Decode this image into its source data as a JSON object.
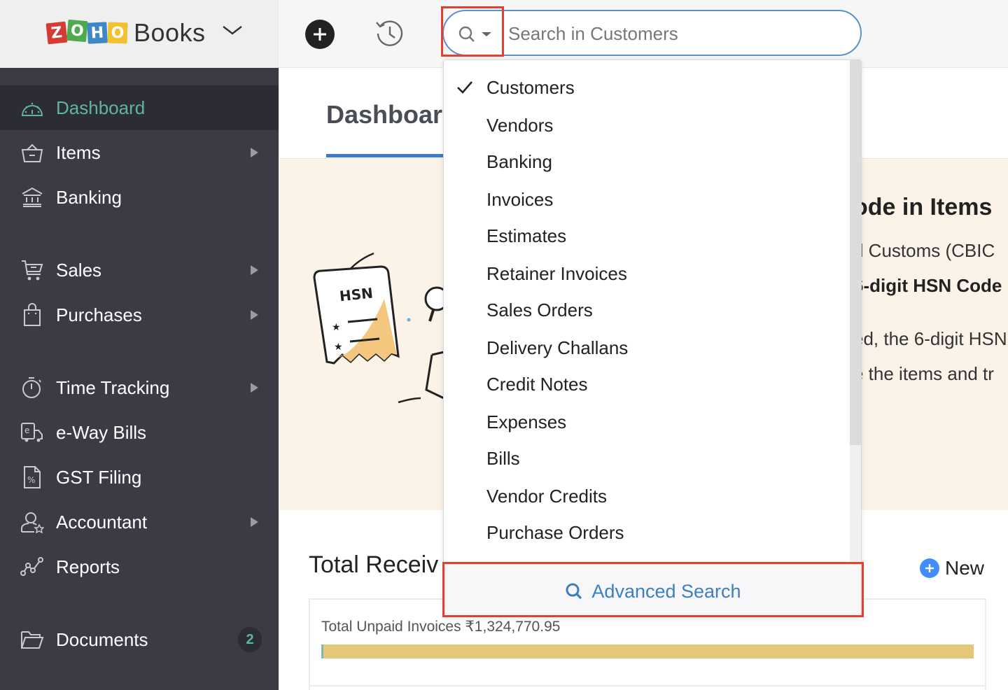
{
  "brand": {
    "logo_letters": [
      "Z",
      "O",
      "H",
      "O"
    ],
    "product_name": "Books"
  },
  "sidebar": {
    "items": [
      {
        "label": "Dashboard",
        "icon": "dashboard-gauge-icon",
        "active": true,
        "has_submenu": false
      },
      {
        "label": "Items",
        "icon": "basket-icon",
        "active": false,
        "has_submenu": true
      },
      {
        "label": "Banking",
        "icon": "bank-icon",
        "active": false,
        "has_submenu": false
      },
      {
        "label": "Sales",
        "icon": "cart-icon",
        "active": false,
        "has_submenu": true
      },
      {
        "label": "Purchases",
        "icon": "shopping-bag-icon",
        "active": false,
        "has_submenu": true
      },
      {
        "label": "Time Tracking",
        "icon": "stopwatch-icon",
        "active": false,
        "has_submenu": true
      },
      {
        "label": "e-Way Bills",
        "icon": "eway-truck-icon",
        "active": false,
        "has_submenu": false
      },
      {
        "label": "GST Filing",
        "icon": "tax-document-icon",
        "active": false,
        "has_submenu": false
      },
      {
        "label": "Accountant",
        "icon": "accountant-user-icon",
        "active": false,
        "has_submenu": true
      },
      {
        "label": "Reports",
        "icon": "reports-graph-icon",
        "active": false,
        "has_submenu": false
      },
      {
        "label": "Documents",
        "icon": "folder-icon",
        "active": false,
        "has_submenu": false,
        "badge": "2"
      }
    ]
  },
  "topbar": {
    "search": {
      "placeholder": "Search in Customers",
      "value": "",
      "selected_scope": "Customers"
    }
  },
  "search_dropdown": {
    "options": [
      {
        "label": "Customers",
        "selected": true
      },
      {
        "label": "Vendors",
        "selected": false
      },
      {
        "label": "Banking",
        "selected": false
      },
      {
        "label": "Invoices",
        "selected": false
      },
      {
        "label": "Estimates",
        "selected": false
      },
      {
        "label": "Retainer Invoices",
        "selected": false
      },
      {
        "label": "Sales Orders",
        "selected": false
      },
      {
        "label": "Delivery Challans",
        "selected": false
      },
      {
        "label": "Credit Notes",
        "selected": false
      },
      {
        "label": "Expenses",
        "selected": false
      },
      {
        "label": "Bills",
        "selected": false
      },
      {
        "label": "Vendor Credits",
        "selected": false
      },
      {
        "label": "Purchase Orders",
        "selected": false
      }
    ],
    "advanced_search_label": "Advanced Search"
  },
  "main": {
    "tab_label": "Dashboard",
    "banner": {
      "title_visible": "ode in Items",
      "illustration_label": "HSN",
      "lines": [
        "d Customs (CBIC",
        "6-digit HSN Code",
        "ed, the 6-digit HSN",
        "e the items and tr"
      ]
    },
    "receivables": {
      "title_visible": "Total Receiv",
      "new_label": "New",
      "unpaid_label": "Total Unpaid Invoices ₹1,324,770.95",
      "unpaid_fraction_shown": 1.0
    }
  },
  "colors": {
    "sidebar_bg": "#3b3b46",
    "active_accent": "#5fb59b",
    "link_blue": "#3d7fc1",
    "highlight_red": "#e5402f",
    "banner_bg": "#fbf3e8",
    "unpaid_bar": "#e5c77a"
  }
}
